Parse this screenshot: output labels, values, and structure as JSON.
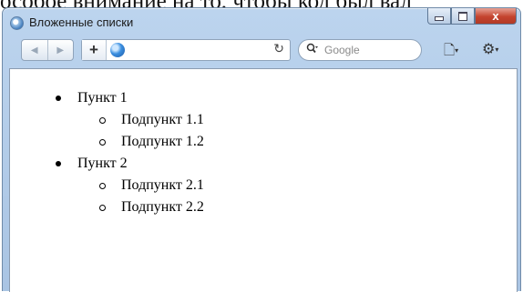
{
  "background": {
    "cropped_text": "особое внимание на то, чтобы код был вал"
  },
  "window": {
    "title": "Вложенные списки",
    "close_glyph": "x"
  },
  "toolbar": {
    "back_glyph": "◀",
    "forward_glyph": "▶",
    "add_glyph": "+",
    "reload_glyph": "↻",
    "search_placeholder": "Google",
    "search_glyph": "🔍",
    "page_glyph": "🗋",
    "gear_glyph": "⚙",
    "caret": "▾"
  },
  "list": {
    "items": [
      {
        "label": "Пункт 1",
        "children": [
          "Подпункт 1.1",
          "Подпункт 1.2"
        ]
      },
      {
        "label": "Пункт 2",
        "children": [
          "Подпункт 2.1",
          "Подпункт 2.2"
        ]
      }
    ]
  }
}
